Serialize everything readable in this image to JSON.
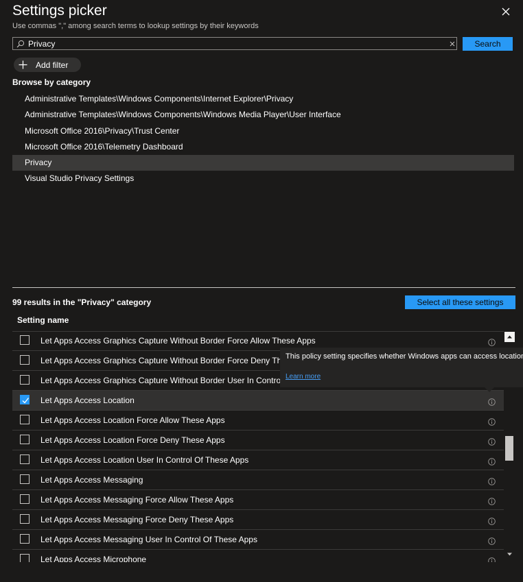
{
  "header": {
    "title": "Settings picker",
    "subtitle": "Use commas \",\" among search terms to lookup settings by their keywords",
    "close_icon": "close-icon"
  },
  "search": {
    "value": "Privacy",
    "placeholder": "",
    "button_label": "Search",
    "icon": "search-icon",
    "clear_icon": "clear-icon"
  },
  "filter": {
    "add_label": "Add filter",
    "icon": "plus-icon"
  },
  "browse": {
    "label": "Browse by category",
    "categories": [
      "Administrative Templates\\Windows Components\\Internet Explorer\\Privacy",
      "Administrative Templates\\Windows Components\\Windows Media Player\\User Interface",
      "Microsoft Office 2016\\Privacy\\Trust Center",
      "Microsoft Office 2016\\Telemetry Dashboard",
      "Privacy",
      "Visual Studio Privacy Settings"
    ],
    "selected_index": 4
  },
  "results": {
    "count_text": "99 results in the \"Privacy\" category",
    "select_all_label": "Select all these settings",
    "column_header": "Setting name",
    "rows": [
      {
        "label": "Let Apps Access Graphics Capture Without Border Force Allow These Apps",
        "checked": false
      },
      {
        "label": "Let Apps Access Graphics Capture Without Border Force Deny These Apps",
        "checked": false
      },
      {
        "label": "Let Apps Access Graphics Capture Without Border User In Control Of These Apps",
        "checked": false
      },
      {
        "label": "Let Apps Access Location",
        "checked": true
      },
      {
        "label": "Let Apps Access Location Force Allow These Apps",
        "checked": false
      },
      {
        "label": "Let Apps Access Location Force Deny These Apps",
        "checked": false
      },
      {
        "label": "Let Apps Access Location User In Control Of These Apps",
        "checked": false
      },
      {
        "label": "Let Apps Access Messaging",
        "checked": false
      },
      {
        "label": "Let Apps Access Messaging Force Allow These Apps",
        "checked": false
      },
      {
        "label": "Let Apps Access Messaging Force Deny These Apps",
        "checked": false
      },
      {
        "label": "Let Apps Access Messaging User In Control Of These Apps",
        "checked": false
      },
      {
        "label": "Let Apps Access Microphone",
        "checked": false
      }
    ]
  },
  "tooltip": {
    "text": "This policy setting specifies whether Windows apps can access location.",
    "link": "Learn more"
  },
  "colors": {
    "accent": "#2899f5",
    "background": "#1b1a19",
    "selected_row": "#3b3a39",
    "link": "#479ef5"
  }
}
